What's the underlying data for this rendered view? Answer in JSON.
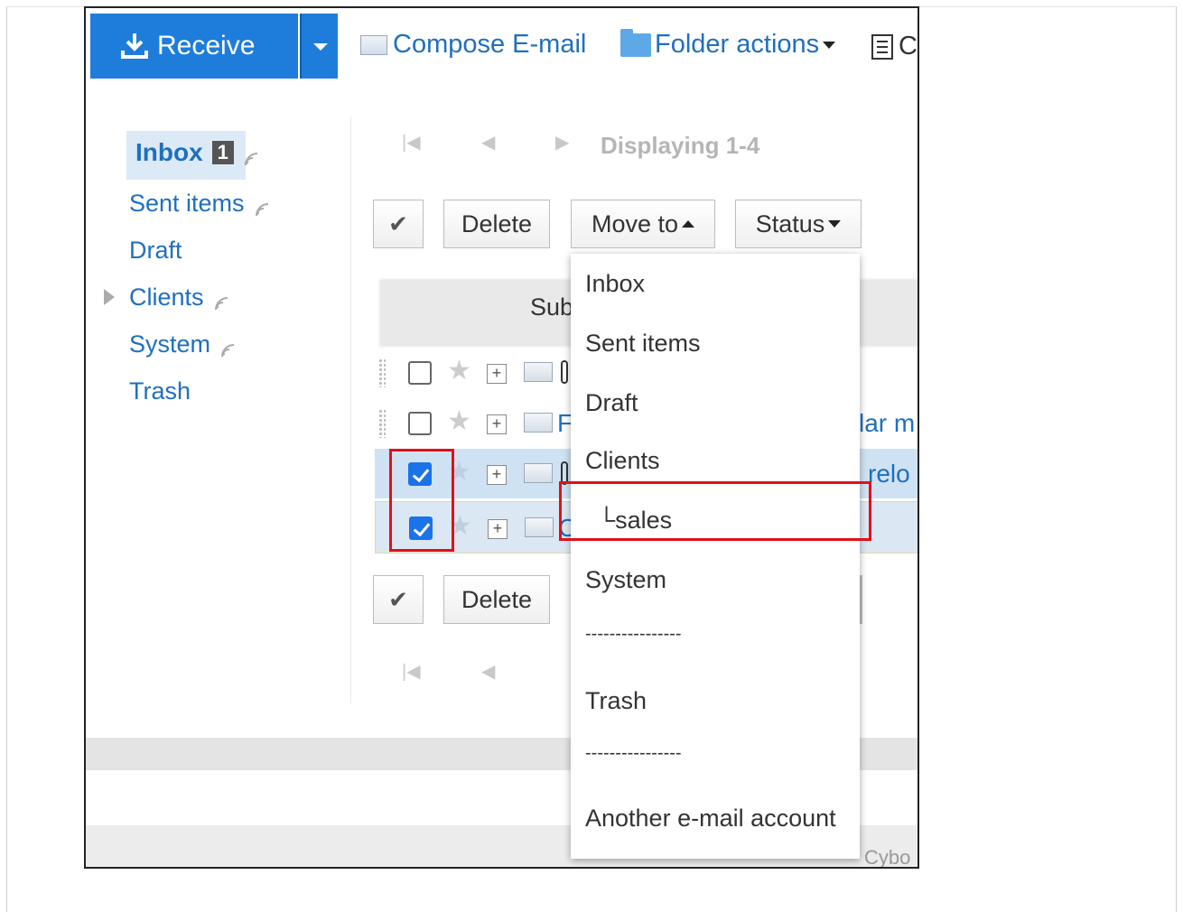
{
  "toolbar": {
    "receive_label": "Receive",
    "compose_label": "Compose E-mail",
    "folder_actions_label": "Folder actions",
    "cut_label": "C"
  },
  "sidebar": {
    "items": [
      {
        "label": "Inbox",
        "badge": "1"
      },
      {
        "label": "Sent items"
      },
      {
        "label": "Draft"
      },
      {
        "label": "Clients"
      },
      {
        "label": "System"
      },
      {
        "label": "Trash"
      }
    ]
  },
  "content": {
    "paging_first": "|◀",
    "paging_prev": "◀",
    "paging_next": "▶",
    "displaying": "Displaying 1-4",
    "delete_label": "Delete",
    "move_to_label": "Move to",
    "status_label": "Status",
    "subject_header_fragment": "Sub",
    "rows": [
      {
        "checked": false,
        "text_left": "",
        "text_right": ""
      },
      {
        "checked": false,
        "text_left": "F",
        "text_right": "lar m"
      },
      {
        "checked": true,
        "text_left": "",
        "text_right": "relo"
      },
      {
        "checked": true,
        "text_left": "C",
        "text_right": ""
      }
    ],
    "footer_fragment": "Cybo"
  },
  "move_menu": {
    "items": [
      "Inbox",
      "Sent items",
      "Draft",
      "Clients",
      "└sales",
      "System",
      "----------------",
      "Trash",
      "----------------",
      "Another e-mail account"
    ],
    "highlighted": "└sales"
  },
  "colors": {
    "accent_blue": "#1e7ddb",
    "link_blue": "#1f6fbf",
    "highlight_red": "#e0101a",
    "selected_row": "#cfe2f3"
  }
}
